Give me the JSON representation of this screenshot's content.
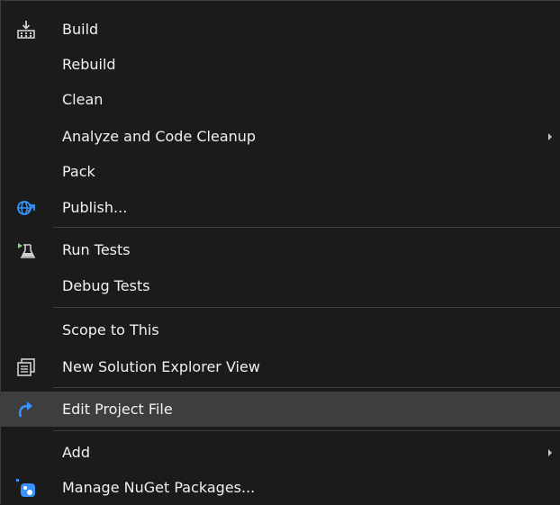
{
  "menu": {
    "items": [
      {
        "label": "Build",
        "icon": "build-icon"
      },
      {
        "label": "Rebuild"
      },
      {
        "label": "Clean"
      },
      {
        "label": "Analyze and Code Cleanup",
        "submenu": true
      },
      {
        "label": "Pack"
      },
      {
        "label": "Publish...",
        "icon": "globe-publish-icon"
      },
      {
        "label": "Run Tests",
        "icon": "run-tests-icon"
      },
      {
        "label": "Debug Tests"
      },
      {
        "label": "Scope to This"
      },
      {
        "label": "New Solution Explorer View",
        "icon": "new-solution-explorer-view-icon"
      },
      {
        "label": "Edit Project File",
        "icon": "edit-redo-arrow-icon",
        "highlighted": true
      },
      {
        "label": "Add",
        "submenu": true
      },
      {
        "label": "Manage NuGet Packages...",
        "icon": "nuget-icon"
      }
    ]
  },
  "colors": {
    "background": "#1b1b1c",
    "highlight": "#3e3e40",
    "text": "#f1f1f1",
    "separator": "#3f3f46",
    "accent_blue": "#3794ff"
  }
}
